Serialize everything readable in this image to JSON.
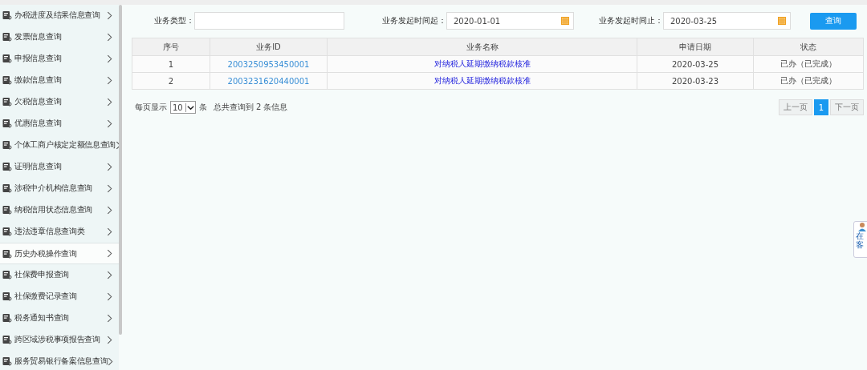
{
  "sidebar": {
    "items": [
      {
        "label": "办税进度及结果信息查询",
        "selected": false
      },
      {
        "label": "发票信息查询",
        "selected": false
      },
      {
        "label": "申报信息查询",
        "selected": false
      },
      {
        "label": "缴款信息查询",
        "selected": false
      },
      {
        "label": "欠税信息查询",
        "selected": false
      },
      {
        "label": "优惠信息查询",
        "selected": false
      },
      {
        "label": "个体工商户核定定额信息查询",
        "selected": false
      },
      {
        "label": "证明信息查询",
        "selected": false
      },
      {
        "label": "涉税中介机构信息查询",
        "selected": false
      },
      {
        "label": "纳税信用状态信息查询",
        "selected": false
      },
      {
        "label": "违法违章信息查询类",
        "selected": false
      },
      {
        "label": "历史办税操作查询",
        "selected": true
      },
      {
        "label": "社保费申报查询",
        "selected": false
      },
      {
        "label": "社保缴费记录查询",
        "selected": false
      },
      {
        "label": "税务通知书查询",
        "selected": false
      },
      {
        "label": "跨区域涉税事项报告查询",
        "selected": false
      },
      {
        "label": "服务贸易银行备案信息查询",
        "selected": false
      }
    ]
  },
  "filters": [
    {
      "label": "业务类型：",
      "kind": "text"
    },
    {
      "label": "业务发起时间起：",
      "kind": "date",
      "value": "2020-01-01"
    },
    {
      "label": "业务发起时间止：",
      "kind": "date",
      "value": "2020-03-25"
    }
  ],
  "search_button": "查询",
  "table": {
    "columns": [
      "序号",
      "业务ID",
      "业务名称",
      "申请日期",
      "状态"
    ],
    "rows": [
      [
        "1",
        "2003250953450001",
        "对纳税人延期缴纳税款核准",
        "2020-03-25",
        "已办（已完成）"
      ],
      [
        "2",
        "2003231620440001",
        "对纳税人延期缴纳税款核准",
        "2020-03-23",
        "已办（已完成）"
      ]
    ]
  },
  "pager": {
    "per_page_label": "每页显示",
    "page_size": "10",
    "unit": "条",
    "total": "总共查询到 2 条信息",
    "buttons": [
      {
        "label": "上一页",
        "selected": false
      },
      {
        "label": "1",
        "selected": true
      },
      {
        "label": "下一页",
        "selected": false
      }
    ]
  },
  "chat_widget": {
    "lines": [
      "在",
      "客"
    ]
  }
}
